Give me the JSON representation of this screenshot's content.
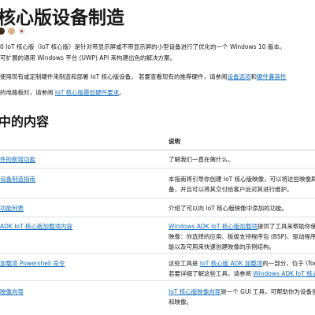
{
  "title": "核心版设备制造",
  "intro": {
    "line1": "0 IoT 核心版（IoT 核心版）是针对带显示屏或不带显示屏的小型设备进行了优化的一个 Windows 10 版本。",
    "line2": "可扩展的通用 Windows 平台 (UWP) API 来构建出色的解决方案。",
    "line3_pre": "使用现有或定制硬件来制造和部署 IoT 核心版设备。 若要查看现有的推荐硬件，请参阅",
    "line3_link1": "设备选项",
    "line3_mid": "和",
    "line3_link2": "硬件兼容性",
    "line4_pre": "的电路板时，请参阅 ",
    "line4_link": "IoT 核心版最低硬件要求",
    "line4_post": "。"
  },
  "section_heading": "中的内容",
  "table": {
    "col2_header": "说明",
    "rows": [
      {
        "topic": "件的新增功能",
        "desc": [
          "了解我们一直在做什么。"
        ]
      },
      {
        "topic": "设备制造指南",
        "desc": [
          "本指南将引导你创建 IoT 核心版映像，可以将这些映像刷",
          "备，并且可以将其交付给客户后对其进行维护。"
        ]
      },
      {
        "topic": "功能列表",
        "desc": [
          "介绍了可以向 IoT 核心版映像中添加的功能。"
        ]
      },
      {
        "topic": "ADK IoT 核心版加载项内容",
        "desc": [
          {
            "link": "Windows ADK IoT 核心版加载项",
            "text": "提供了工具来帮助你使用下列项目自"
          },
          {
            "text": "映像：你选择的应用、板级支持程序包 (BSP)、驱动程序和"
          },
          {
            "text": "能以及可用来快速创建映像的示例结构。"
          }
        ]
      },
      {
        "topic": "加载项 Powershell 命令",
        "desc": [
          {
            "pre": "这些工具是 ",
            "link": "IoT 核心版 ADK 加载项",
            "text": "的一部分，位于 \\Tool"
          },
          {
            "pre": "若要详细了解这些工具，请参阅 ",
            "link": "Windows ADK IoT 核心"
          }
        ]
      },
      {
        "topic": "映像向导",
        "desc": [
          {
            "link": "IoT 核心版映像向导",
            "text": "是一个 GUI 工具，可帮助你为设备创建"
          },
          {
            "text": "和映像。"
          }
        ]
      }
    ]
  },
  "colors": {
    "link": "#0f6cbd",
    "text": "#171717",
    "divider": "#e0e0e0"
  }
}
